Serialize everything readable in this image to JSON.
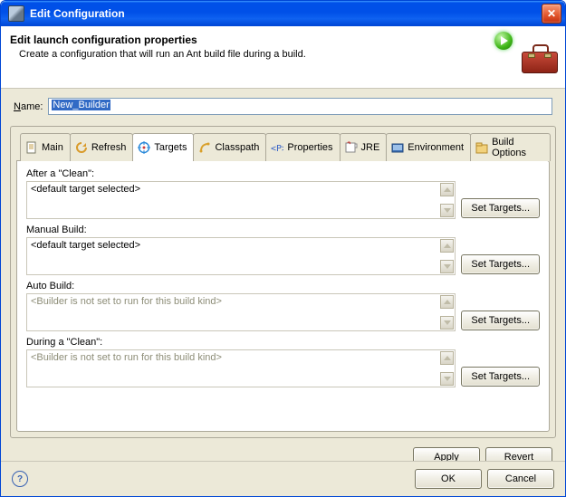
{
  "window": {
    "title": "Edit Configuration"
  },
  "banner": {
    "heading": "Edit launch configuration properties",
    "description": "Create a configuration that will run an Ant build file during a build."
  },
  "name": {
    "label_rest": "ame:",
    "value": "New_Builder"
  },
  "tabs": [
    {
      "label": "Main"
    },
    {
      "label": "Refresh"
    },
    {
      "label": "Targets",
      "active": true
    },
    {
      "label": "Classpath"
    },
    {
      "label": "Properties"
    },
    {
      "label": "JRE"
    },
    {
      "label": "Environment"
    },
    {
      "label": "Build Options"
    }
  ],
  "groups": [
    {
      "id": "after_clean",
      "label": "After a \"Clean\":",
      "content": "<default target selected>",
      "enabled": true
    },
    {
      "id": "manual_build",
      "label": "Manual Build:",
      "content": "<default target selected>",
      "enabled": true
    },
    {
      "id": "auto_build",
      "label": "Auto Build:",
      "content": "<Builder is not set to run for this build kind>",
      "enabled": false
    },
    {
      "id": "during_clean",
      "label": "During a \"Clean\":",
      "content": "<Builder is not set to run for this build kind>",
      "enabled": false
    }
  ],
  "buttons": {
    "set_targets": "Set Targets...",
    "apply": "Apply",
    "revert": "Revert",
    "ok": "OK",
    "cancel": "Cancel"
  }
}
